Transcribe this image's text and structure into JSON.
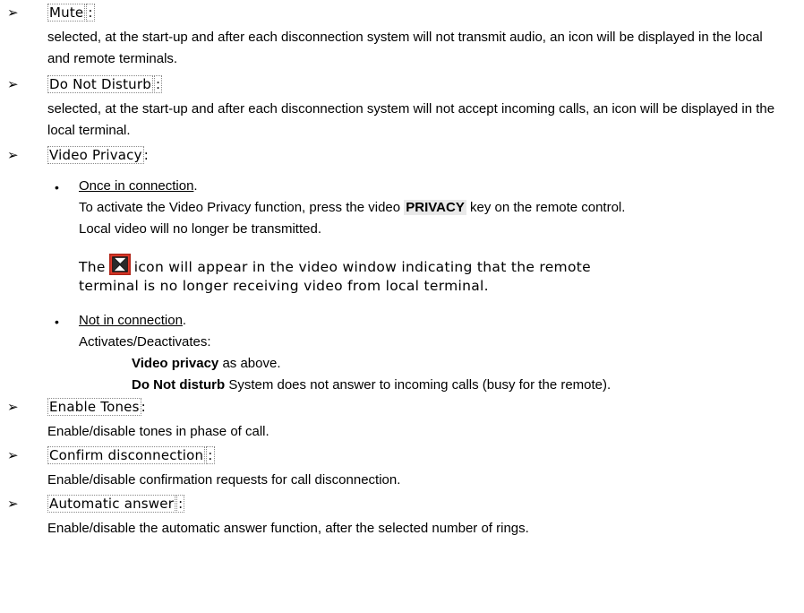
{
  "items": [
    {
      "label": "Mute",
      "desc": "selected, at the start-up and after each disconnection system will not transmit audio, an icon will be displayed in the local and remote terminals."
    },
    {
      "label": "Do Not Disturb",
      "desc": "selected, at the start-up and after each disconnection system will not accept incoming calls, an icon will be displayed in the local terminal."
    },
    {
      "label": "Video Privacy"
    },
    {
      "label": "Enable Tones",
      "desc": "Enable/disable tones in phase of call."
    },
    {
      "label": "Confirm disconnection",
      "desc": "Enable/disable confirmation requests for call disconnection."
    },
    {
      "label": "Automatic answer",
      "desc": "Enable/disable the automatic answer function, after the selected number of rings."
    }
  ],
  "video_privacy": {
    "once": {
      "title": "Once in connection",
      "line1_pre": "To activate the Video Privacy function, press the video ",
      "key": "PRIVACY",
      "line1_post": " key on the remote control.",
      "line2": "Local video will no longer be transmitted.",
      "note_pre": "The",
      "note_icon": "video-privacy-icon",
      "note_post": "icon will appear in the video window indicating that the remote",
      "note_line2": "terminal is no longer receiving video from local terminal."
    },
    "not": {
      "title": "Not in connection",
      "activates": "Activates/Deactivates:",
      "opt1_bold": "Video privacy",
      "opt1_rest": " as above.",
      "opt2_bold": "Do Not disturb",
      "opt2_rest": " System does not answer to incoming calls (busy for the remote)."
    }
  },
  "glyphs": {
    "arrow": "➢",
    "bullet": "•",
    "colon": ":"
  }
}
